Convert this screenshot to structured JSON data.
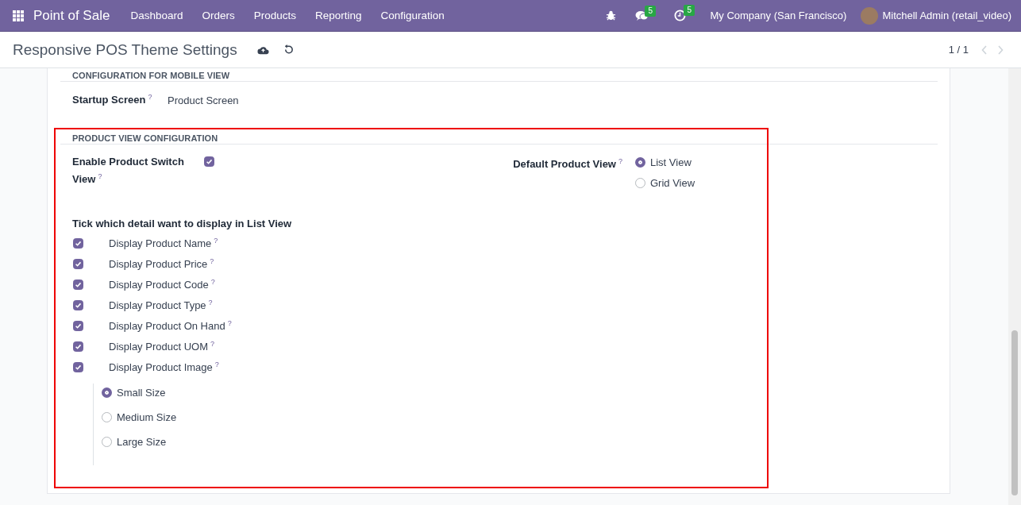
{
  "navbar": {
    "app": "Point of Sale",
    "menu": [
      "Dashboard",
      "Orders",
      "Products",
      "Reporting",
      "Configuration"
    ],
    "messages_badge": "5",
    "activities_badge": "5",
    "company": "My Company (San Francisco)",
    "user": "Mitchell Admin (retail_video)"
  },
  "control_panel": {
    "title": "Responsive POS Theme Settings",
    "pager": "1 / 1"
  },
  "mobile_section": {
    "heading": "CONFIGURATION FOR MOBILE VIEW",
    "label": "Startup Screen",
    "help": "?",
    "value": "Product Screen"
  },
  "product_section": {
    "heading": "PRODUCT VIEW CONFIGURATION",
    "switch": {
      "label": "Enable Product Switch View",
      "help": "?",
      "checked": true
    },
    "default_view": {
      "label": "Default Product View",
      "help": "?",
      "options": [
        {
          "label": "List View",
          "selected": true
        },
        {
          "label": "Grid View",
          "selected": false
        }
      ]
    },
    "list_heading": "Tick which detail want to display in List View",
    "details": [
      {
        "label": "Display Product Name",
        "help": "?",
        "checked": true
      },
      {
        "label": "Display Product Price",
        "help": "?",
        "checked": true
      },
      {
        "label": "Display Product Code",
        "help": "?",
        "checked": true
      },
      {
        "label": "Display Product Type",
        "help": "?",
        "checked": true
      },
      {
        "label": "Display Product On Hand",
        "help": "?",
        "checked": true
      },
      {
        "label": "Display Product UOM",
        "help": "?",
        "checked": true
      },
      {
        "label": "Display Product Image",
        "help": "?",
        "checked": true
      }
    ],
    "image_sizes": [
      {
        "label": "Small Size",
        "selected": true
      },
      {
        "label": "Medium Size",
        "selected": false
      },
      {
        "label": "Large Size",
        "selected": false
      }
    ]
  }
}
